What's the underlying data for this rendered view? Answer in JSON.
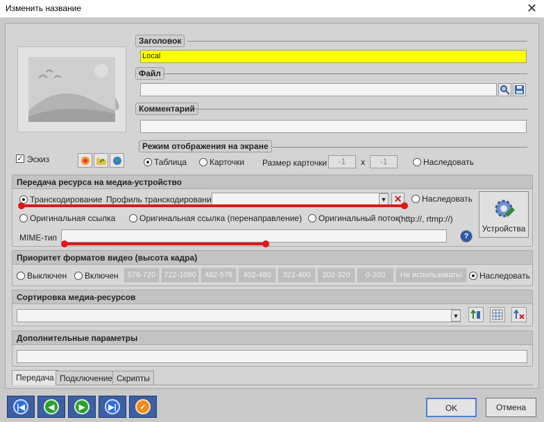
{
  "window": {
    "title": "Изменить название",
    "close": "✕"
  },
  "header": {
    "title_label": "Заголовок",
    "title_value": "Local",
    "file_label": "Файл",
    "file_value": "",
    "comment_label": "Комментарий",
    "comment_value": "",
    "sketch_label": "Эскиз",
    "sketch_checked": true
  },
  "display_mode": {
    "label": "Режим отображения на экране",
    "table": "Таблица",
    "cards": "Карточки",
    "card_size_label": "Размер карточки",
    "card_w": "-1",
    "x": "x",
    "card_h": "-1",
    "inherit": "Наследовать",
    "selected": "table"
  },
  "transfer": {
    "label": "Передача ресурса на медиа-устройство",
    "transcoding": "Транскодирование",
    "profile_label": "Профиль транскодирования",
    "profile_value": "",
    "inherit": "Наследовать",
    "original_link": "Оригинальная ссылка",
    "original_link_redirect": "Оригинальная ссылка (перенаправление)",
    "original_stream": "Оригинальный поток",
    "stream_hint": "(http://, rtmp://)",
    "mime_label": "MIME-тип",
    "mime_value": "",
    "devices_label": "Устройства",
    "selected": "transcoding"
  },
  "video_priority": {
    "label": "Приоритет форматов видео (высота кадра)",
    "off": "Выключен",
    "on": "Включен",
    "chips": [
      "578-720",
      "722-1080",
      "482-576",
      "402-480",
      "322-400",
      "202-320",
      "0-200",
      "Не использовать!"
    ],
    "inherit": "Наследовать",
    "selected": "inherit"
  },
  "sorting": {
    "label": "Сортировка медиа-ресурсов",
    "value": ""
  },
  "extra": {
    "label": "Дополнительные параметры",
    "value": ""
  },
  "tabs": [
    "Передача",
    "Подключение",
    "Скрипты"
  ],
  "footer": {
    "ok": "OK",
    "cancel": "Отмена"
  },
  "colors": {
    "title_input": "#ffff00",
    "annotation": "#e01818",
    "nav_button": "#3c5fa3"
  }
}
